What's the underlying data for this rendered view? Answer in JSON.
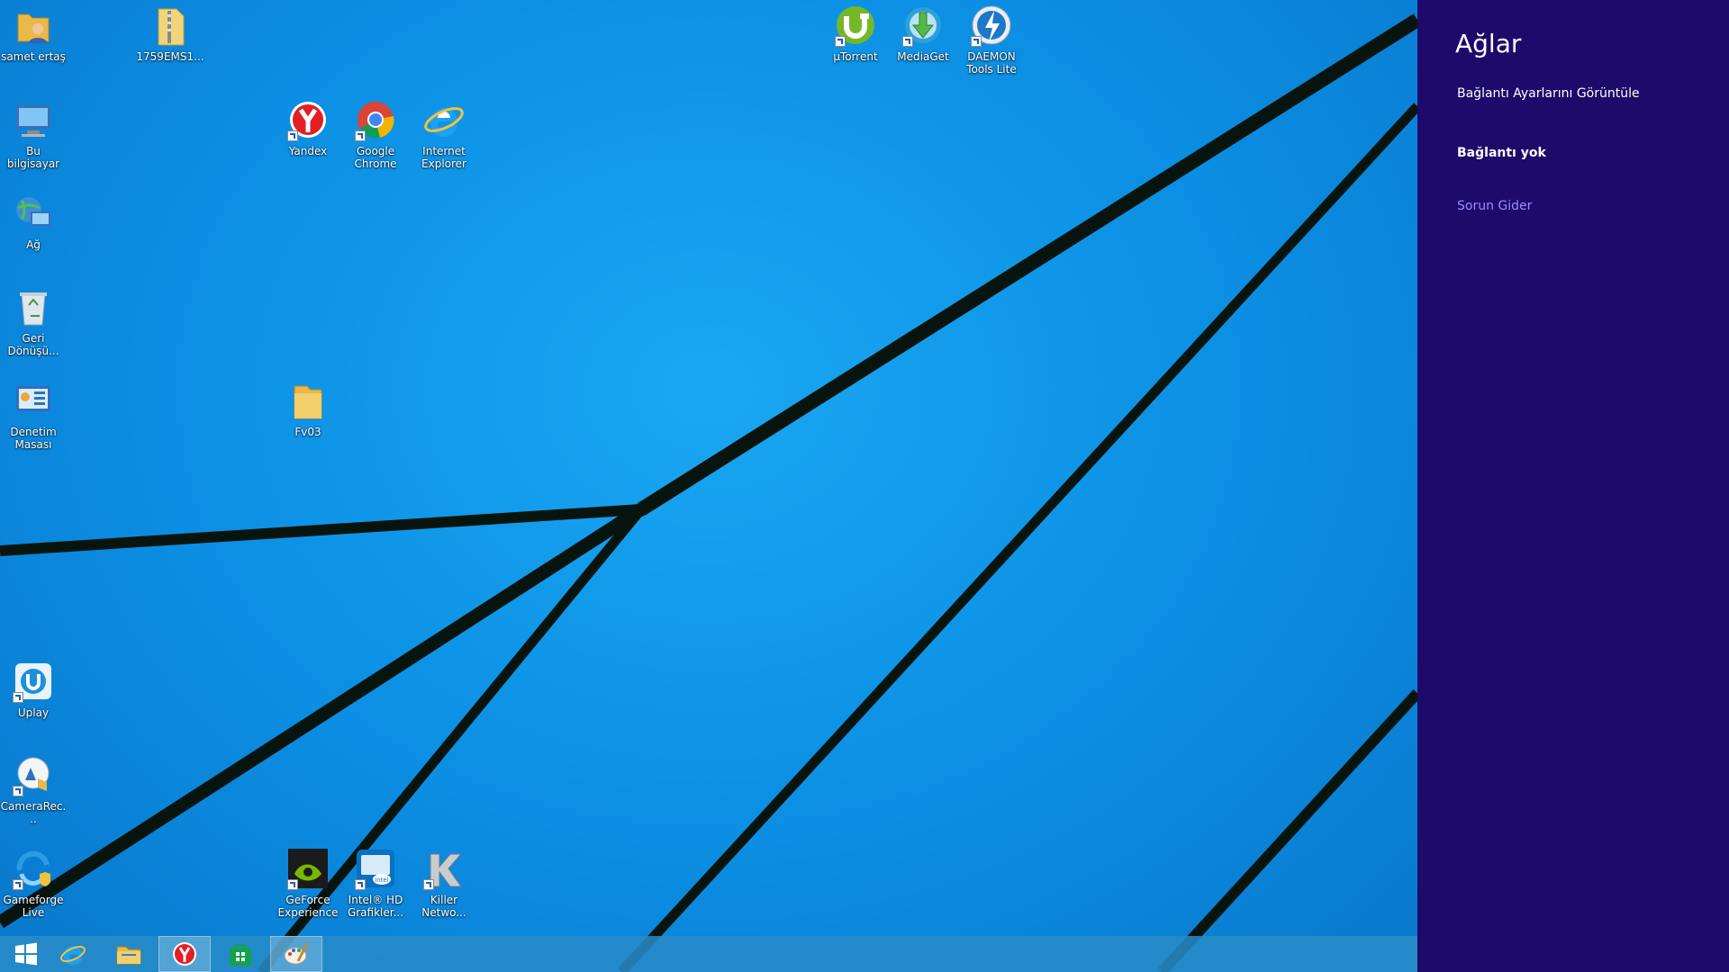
{
  "desktop": {
    "icons": [
      {
        "id": "samet-ertas",
        "label": "samet ertaş",
        "icon": "user-folder-icon"
      },
      {
        "id": "1759ems",
        "label": "1759EMS1...",
        "icon": "zip-folder-icon"
      },
      {
        "id": "bu-bilgisayar",
        "label": "Bu bilgisayar",
        "icon": "computer-icon"
      },
      {
        "id": "ag",
        "label": "Ağ",
        "icon": "network-icon"
      },
      {
        "id": "geri-donusum",
        "label": "Geri Dönüşü...",
        "icon": "recycle-bin-icon"
      },
      {
        "id": "denetim-masasi",
        "label": "Denetim Masası",
        "icon": "control-panel-icon"
      },
      {
        "id": "uplay",
        "label": "Uplay",
        "icon": "uplay-icon"
      },
      {
        "id": "camerarec",
        "label": "CameraRec...",
        "icon": "camera-rec-icon"
      },
      {
        "id": "gameforge",
        "label": "Gameforge Live",
        "icon": "gameforge-icon"
      },
      {
        "id": "yandex",
        "label": "Yandex",
        "icon": "yandex-icon"
      },
      {
        "id": "chrome",
        "label": "Google Chrome",
        "icon": "chrome-icon"
      },
      {
        "id": "ie",
        "label": "Internet Explorer",
        "icon": "internet-explorer-icon"
      },
      {
        "id": "fv03",
        "label": "Fv03",
        "icon": "folder-icon"
      },
      {
        "id": "utorrent",
        "label": "µTorrent",
        "icon": "utorrent-icon"
      },
      {
        "id": "mediaget",
        "label": "MediaGet",
        "icon": "mediaget-icon"
      },
      {
        "id": "daemon",
        "label": "DAEMON Tools Lite",
        "icon": "daemon-tools-icon"
      },
      {
        "id": "geforce",
        "label": "GeForce Experience",
        "icon": "geforce-icon"
      },
      {
        "id": "intel-hd",
        "label": "Intel® HD Grafikler...",
        "icon": "intel-hd-icon"
      },
      {
        "id": "killer",
        "label": "Killer Netwo...",
        "icon": "killer-network-icon"
      }
    ]
  },
  "taskbar": {
    "items": [
      {
        "id": "start",
        "icon": "windows-start-icon"
      },
      {
        "id": "ie",
        "icon": "internet-explorer-icon"
      },
      {
        "id": "explorer",
        "icon": "file-explorer-icon"
      },
      {
        "id": "yandex",
        "icon": "yandex-icon",
        "active": true
      },
      {
        "id": "store",
        "icon": "store-icon"
      },
      {
        "id": "paint",
        "icon": "paint-icon",
        "active": true
      }
    ]
  },
  "charm": {
    "title": "Ağlar",
    "view_settings": "Bağlantı Ayarlarını Görüntüle",
    "status": "Bağlantı yok",
    "troubleshoot": "Sorun Gider",
    "background": "#1d0a6a",
    "link_color": "#9b8cff"
  }
}
